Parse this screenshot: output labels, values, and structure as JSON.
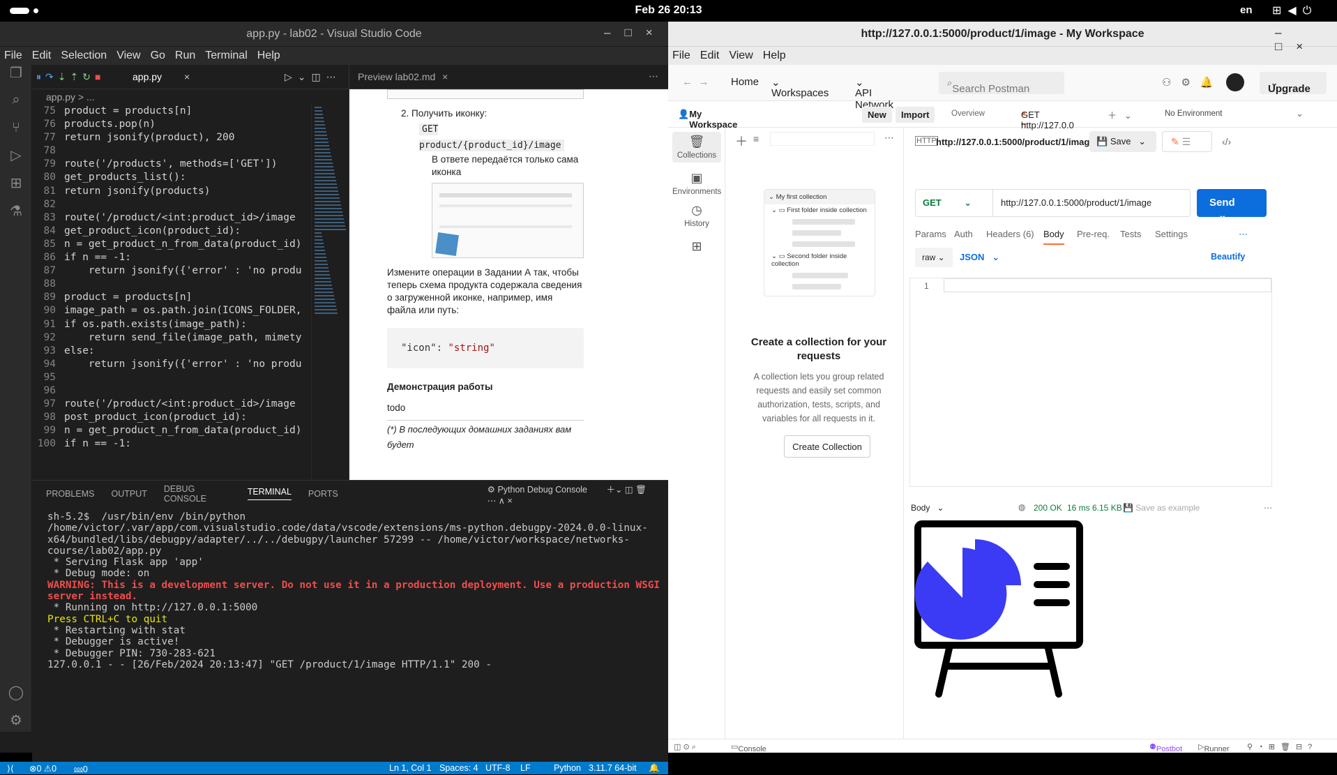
{
  "topbar": {
    "clock": "Feb 26  20:13",
    "lang": "en"
  },
  "vscode": {
    "title": "app.py - lab02 - Visual Studio Code",
    "menu": [
      "File",
      "Edit",
      "Selection",
      "View",
      "Go",
      "Run",
      "Terminal",
      "Help"
    ],
    "tab": "app.py",
    "breadcrumb": "app.py > ...",
    "preview_tab": "Preview lab02.md",
    "code": [
      {
        "n": "75",
        "t": "product = products[n]"
      },
      {
        "n": "76",
        "t": "products.pop(n)"
      },
      {
        "n": "77",
        "t": "return jsonify(product), 200"
      },
      {
        "n": "78",
        "t": ""
      },
      {
        "n": "79",
        "t": "route('/products', methods=['GET'])"
      },
      {
        "n": "80",
        "t": "get_products_list():"
      },
      {
        "n": "81",
        "t": "return jsonify(products)"
      },
      {
        "n": "82",
        "t": ""
      },
      {
        "n": "83",
        "t": "route('/product/<int:product_id>/image"
      },
      {
        "n": "84",
        "t": "get_product_icon(product_id):"
      },
      {
        "n": "85",
        "t": "n = get_product_n_from_data(product_id)"
      },
      {
        "n": "86",
        "t": "if n == -1:"
      },
      {
        "n": "87",
        "t": "    return jsonify({'error' : 'no produ"
      },
      {
        "n": "88",
        "t": ""
      },
      {
        "n": "89",
        "t": "product = products[n]"
      },
      {
        "n": "90",
        "t": "image_path = os.path.join(ICONS_FOLDER,"
      },
      {
        "n": "91",
        "t": "if os.path.exists(image_path):"
      },
      {
        "n": "92",
        "t": "    return send_file(image_path, mimety"
      },
      {
        "n": "93",
        "t": "else:"
      },
      {
        "n": "94",
        "t": "    return jsonify({'error' : 'no produ"
      },
      {
        "n": "95",
        "t": ""
      },
      {
        "n": "96",
        "t": ""
      },
      {
        "n": "97",
        "t": "route('/product/<int:product_id>/image"
      },
      {
        "n": "98",
        "t": "post_product_icon(product_id):"
      },
      {
        "n": "99",
        "t": "n = get_product_n_from_data(product_id)"
      },
      {
        "n": "100",
        "t": "if n == -1:"
      }
    ],
    "preview": {
      "item2": "2. Получить иконку:",
      "endpoint": "GET product/{product_id}/image",
      "bullet": "В ответе передаётся только сама иконка",
      "para": "Измените операции в Задании А так, чтобы теперь схема продукта содержала сведения о загруженной иконке, например, имя файла или путь:",
      "code_key": "\"icon\"",
      "code_val": "\"string\"",
      "heading": "Демонстрация работы",
      "todo": "todo",
      "footnote": "(*) В последующих домашних заданиях вам будет"
    },
    "panel_tabs": [
      "PROBLEMS",
      "OUTPUT",
      "DEBUG CONSOLE",
      "TERMINAL",
      "PORTS"
    ],
    "terminal_label": "Python Debug Console",
    "terminal": {
      "l1": "sh-5.2$  /usr/bin/env /bin/python /home/victor/.var/app/com.visualstudio.code/data/vscode/extensions/ms-python.debugpy-2024.0.0-linux-x64/bundled/libs/debugpy/adapter/../../debugpy/launcher 57299 -- /home/victor/workspace/networks-course/lab02/app.py",
      "l2": " * Serving Flask app 'app'",
      "l3": " * Debug mode: on",
      "warn": "WARNING: This is a development server. Do not use it in a production deployment. Use a production WSGI server instead.",
      "l4": " * Running on http://127.0.0.1:5000",
      "l5": "Press CTRL+C to quit",
      "l6": " * Restarting with stat",
      "l7": " * Debugger is active!",
      "l8": " * Debugger PIN: 730-283-621",
      "l9": "127.0.0.1 - - [26/Feb/2024 20:13:47] \"GET /product/1/image HTTP/1.1\" 200 -"
    },
    "status": {
      "errors": "⊗0 ⚠0",
      "ports": "⅏0",
      "pos": "Ln 1, Col 1",
      "spaces": "Spaces: 4",
      "enc": "UTF-8",
      "eol": "LF",
      "lang": "Python",
      "ver": "3.11.7 64-bit"
    }
  },
  "postman": {
    "title": "http://127.0.0.1:5000/product/1/image - My Workspace",
    "menu": [
      "File",
      "Edit",
      "View",
      "Help"
    ],
    "nav": {
      "home": "Home",
      "workspaces": "Workspaces",
      "api": "API Network",
      "search": "Search Postman",
      "upgrade": "Upgrade"
    },
    "workspace": "My Workspace",
    "new": "New",
    "import": "Import",
    "overview": "Overview",
    "tab": "GET http://127.0.0",
    "env": "No Environment",
    "side": [
      "Collections",
      "Environments",
      "History"
    ],
    "collection": {
      "name": "My first collection",
      "f1": "First folder inside collection",
      "f2": "Second folder inside collection",
      "title": "Create a collection for your requests",
      "desc": "A collection lets you group related requests and easily set common authorization, tests, scripts, and variables for all requests in it.",
      "btn": "Create Collection"
    },
    "request": {
      "name": "http://127.0.0.1:5000/product/1/image",
      "save": "Save",
      "method": "GET",
      "url": "http://127.0.0.1:5000/product/1/image",
      "send": "Send",
      "tabs": [
        "Params",
        "Auth",
        "Headers (6)",
        "Body",
        "Pre-req.",
        "Tests",
        "Settings"
      ],
      "raw": "raw",
      "json": "JSON",
      "beautify": "Beautify",
      "line": "1"
    },
    "response": {
      "body": "Body",
      "status": "200 OK",
      "time": "16 ms",
      "size": "6.15 KB",
      "save": "Save as example"
    },
    "footer": {
      "console": "Console",
      "postbot": "Postbot",
      "runner": "Runner"
    }
  }
}
